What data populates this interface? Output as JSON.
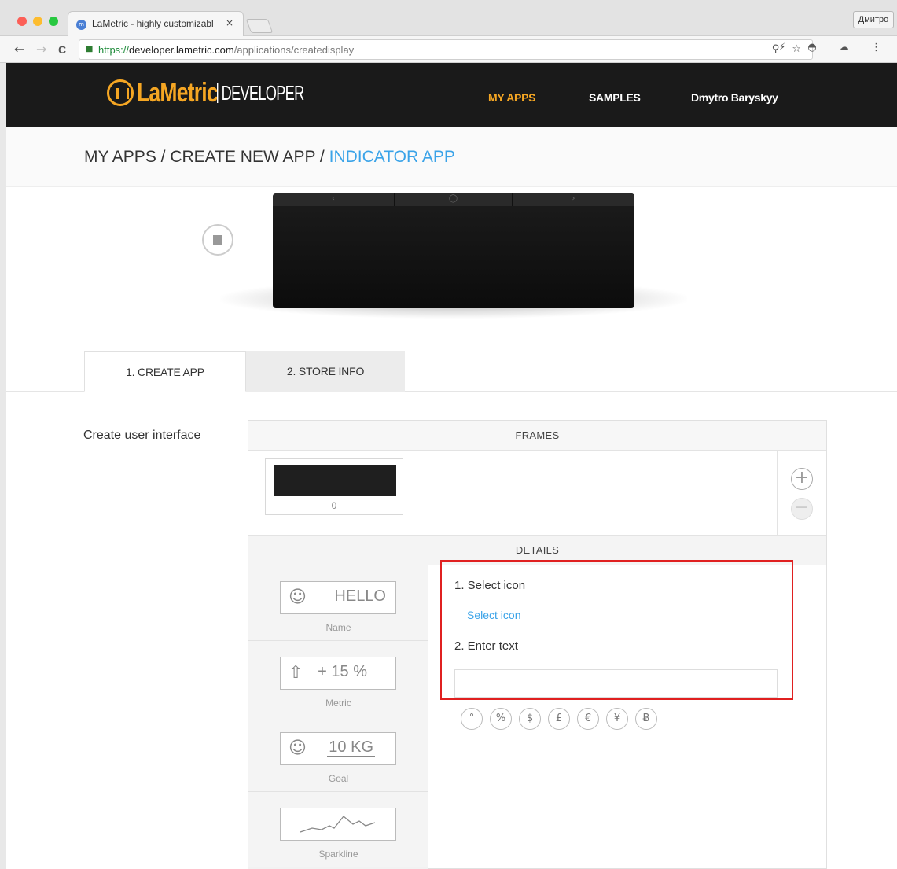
{
  "browser": {
    "tab_title": "LaMetric - highly customizabl",
    "tab_close": "×",
    "favicon_glyph": "m",
    "profile_label": "Дмитро",
    "url_scheme": "https://",
    "url_host": "developer.lametric.com",
    "url_path": "/applications/createdisplay",
    "nav_back": "←",
    "nav_forward": "→",
    "nav_reload": "C",
    "lock_glyph": "🔒",
    "omni_icons": "⚲ ☆",
    "ext_icons": "⚡ ◓ ☁ ⋮"
  },
  "header": {
    "logo_text": "LaMetric",
    "logo_suffix": "DEVELOPER",
    "nav": {
      "my_apps": "MY APPS",
      "samples": "SAMPLES",
      "user": "Dmytro Baryskyy"
    },
    "accent_color": "#f5a623"
  },
  "breadcrumb": {
    "part1": "MY APPS / CREATE NEW APP / ",
    "current": "INDICATOR APP"
  },
  "device": {
    "left_arrow": "‹",
    "center_button": "◯",
    "right_arrow": "›"
  },
  "steps": {
    "tab1": "1. CREATE APP",
    "tab2": "2. STORE INFO"
  },
  "section_label": "Create user interface",
  "frames": {
    "header": "FRAMES",
    "items": [
      {
        "index": "0"
      }
    ],
    "add_glyph": "+",
    "remove_glyph": "−"
  },
  "details": {
    "header": "DETAILS",
    "types": [
      {
        "icon": "☺",
        "text": "HELLO",
        "name": "Name"
      },
      {
        "icon": "⇧",
        "text": "+ 15 %",
        "name": "Metric"
      },
      {
        "icon": "☺",
        "text": "10 KG",
        "name": "Goal"
      },
      {
        "icon": "",
        "text": "",
        "name": "Sparkline"
      }
    ],
    "step1_label": "1. Select icon",
    "select_link": "Select icon",
    "step2_label": "2. Enter text",
    "text_value": "",
    "symbols": [
      "°",
      "%",
      "$",
      "£",
      "€",
      "¥",
      "Ƀ"
    ]
  },
  "colors": {
    "link_blue": "#3aa3e8",
    "highlight_red": "#e02020",
    "header_bg": "#1a1a1a"
  }
}
